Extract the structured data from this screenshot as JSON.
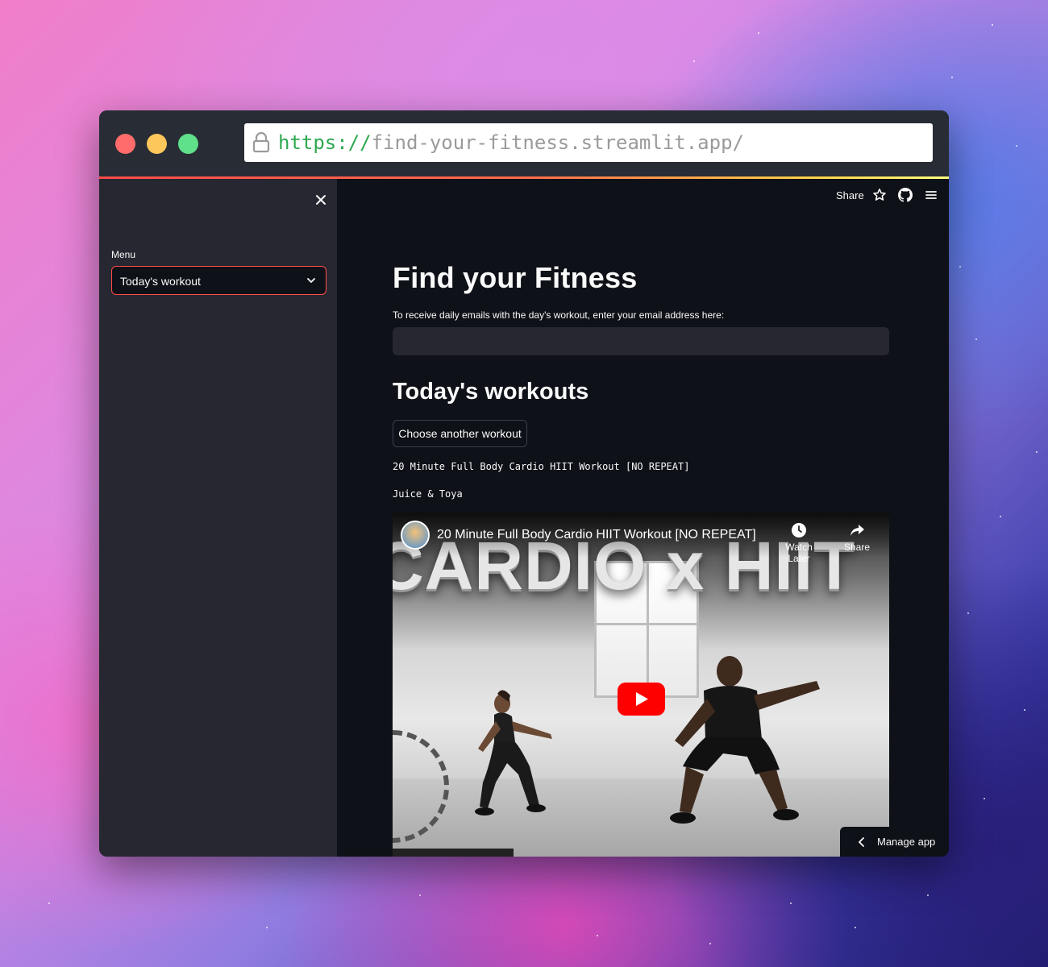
{
  "browser": {
    "url_scheme": "https://",
    "url_rest": "find-your-fitness.streamlit.app/"
  },
  "sidebar": {
    "close_icon": "close-icon",
    "menu_label": "Menu",
    "select_value": "Today's workout"
  },
  "toolbar": {
    "share_label": "Share",
    "icons": [
      "star-icon",
      "github-icon",
      "hamburger-menu-icon"
    ]
  },
  "main": {
    "title": "Find your Fitness",
    "email_label": "To receive daily emails with the day's workout, enter your email address here:",
    "email_value": "",
    "workouts_heading": "Today's workouts",
    "choose_button": "Choose another workout",
    "workout_title": "20 Minute Full Body Cardio HIIT Workout [NO REPEAT]",
    "workout_author": "Juice & Toya"
  },
  "video": {
    "title": "20 Minute Full Body Cardio HIIT Workout [NO REPEAT]",
    "thumbnail_text": "CARDIO x HIIT",
    "watch_later": "Watch Later",
    "share": "Share"
  },
  "manage_app": {
    "label": "Manage app"
  },
  "colors": {
    "accent": "#ff4b4b",
    "background": "#0e1117",
    "sidebar": "#262730",
    "text": "#fafafa",
    "url_scheme": "#2fa84f",
    "youtube_red": "#ff0000"
  }
}
